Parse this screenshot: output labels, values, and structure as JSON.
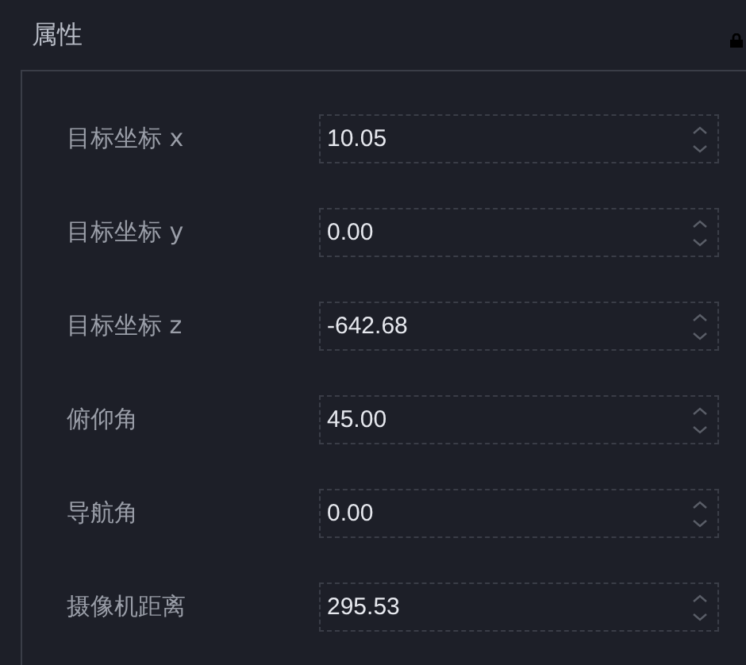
{
  "panel": {
    "title": "属性"
  },
  "fields": [
    {
      "label": "目标坐标 x",
      "value": "10.05"
    },
    {
      "label": "目标坐标 y",
      "value": "0.00"
    },
    {
      "label": "目标坐标 z",
      "value": "-642.68"
    },
    {
      "label": "俯仰角",
      "value": "45.00"
    },
    {
      "label": "导航角",
      "value": "0.00"
    },
    {
      "label": "摄像机距离",
      "value": "295.53"
    }
  ]
}
